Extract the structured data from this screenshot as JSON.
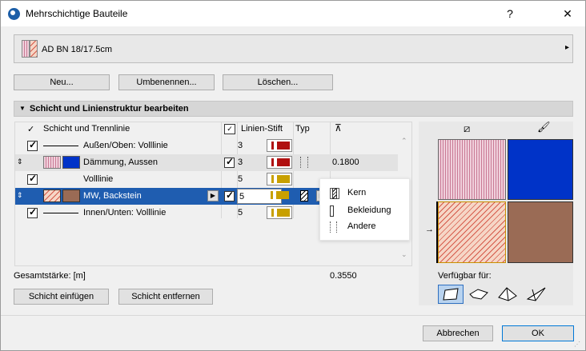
{
  "window": {
    "title": "Mehrschichtige Bauteile",
    "help_label": "?",
    "close_label": "✕"
  },
  "selector": {
    "current_name": "AD BN 18/17.5cm",
    "arrow": "▸"
  },
  "actions": {
    "new_label": "Neu...",
    "rename_label": "Umbenennen...",
    "delete_label": "Löschen..."
  },
  "section": {
    "title": "Schicht und Linienstruktur bearbeiten"
  },
  "table": {
    "headers": {
      "layer": "Schicht und Trennlinie",
      "pen": "Linien-Stift",
      "type": "Typ"
    },
    "rows": [
      {
        "kind": "line",
        "label": "Außen/Oben: Volllinie",
        "pen": "3",
        "pen_color": "#b01010",
        "checked": true
      },
      {
        "kind": "layer",
        "label": "Dämmung, Aussen",
        "pen": "3",
        "pen_color": "#b01010",
        "thickness": "0.1800",
        "color": "#0000c0",
        "checked": true
      },
      {
        "kind": "line",
        "label": "Volllinie",
        "pen": "5",
        "pen_color": "#c8a000",
        "checked": true
      },
      {
        "kind": "layer",
        "label": "MW, Backstein",
        "pen": "5",
        "pen_color": "#c8a000",
        "color": "#9a6b55",
        "checked": true,
        "selected": true
      },
      {
        "kind": "line",
        "label": "Innen/Unten: Volllinie",
        "pen": "5",
        "pen_color": "#c8a000",
        "checked": true
      }
    ]
  },
  "popup": {
    "items": [
      "Kern",
      "Bekleidung",
      "Andere"
    ]
  },
  "total": {
    "label": "Gesamtstärke: [m]",
    "value": "0.3550"
  },
  "layer_buttons": {
    "insert_label": "Schicht einfügen",
    "remove_label": "Schicht entfernen"
  },
  "available": {
    "label": "Verfügbar für:"
  },
  "footer": {
    "cancel_label": "Abbrechen",
    "ok_label": "OK"
  },
  "colors": {
    "selection_blue": "#1f5db0",
    "insulation_blue": "#0033c8",
    "brick_brown": "#9a6b55"
  }
}
